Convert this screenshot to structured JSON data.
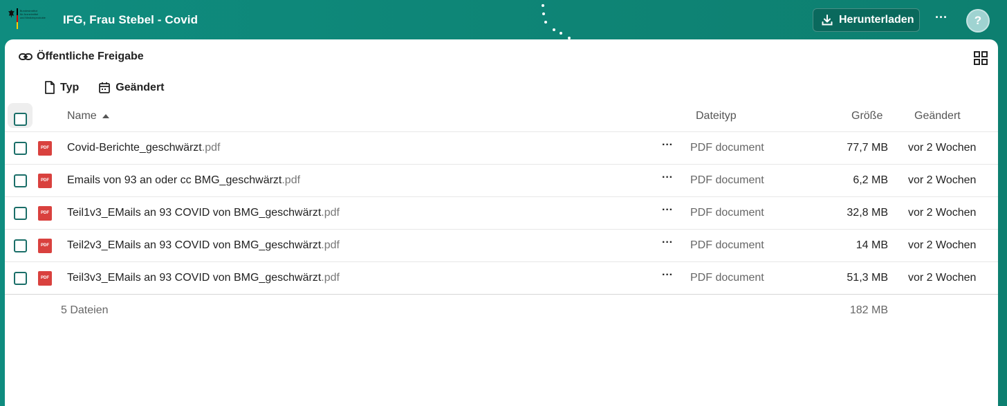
{
  "header": {
    "logo_text": [
      "Bundesinstitut",
      "für Arzneimittel",
      "und Medizinprodukte"
    ],
    "title": "IFG, Frau Stebel - Covid",
    "download_label": "Herunterladen",
    "more_label": "···",
    "help_label": "?"
  },
  "share": {
    "title": "Öffentliche Freigabe"
  },
  "sort": {
    "type_label": "Typ",
    "modified_label": "Geändert"
  },
  "columns": {
    "name": "Name",
    "type": "Dateityp",
    "size": "Größe",
    "modified": "Geändert"
  },
  "files": [
    {
      "name": "Covid-Berichte_geschwärzt",
      "ext": ".pdf",
      "type": "PDF document",
      "size": "77,7 MB",
      "modified": "vor 2 Wochen",
      "icon_label": "PDF"
    },
    {
      "name": "Emails von 93 an oder cc BMG_geschwärzt",
      "ext": ".pdf",
      "type": "PDF document",
      "size": "6,2 MB",
      "modified": "vor 2 Wochen",
      "icon_label": "PDF"
    },
    {
      "name": "Teil1v3_EMails an 93 COVID von BMG_geschwärzt",
      "ext": ".pdf",
      "type": "PDF document",
      "size": "32,8 MB",
      "modified": "vor 2 Wochen",
      "icon_label": "PDF"
    },
    {
      "name": "Teil2v3_EMails an 93 COVID von BMG_geschwärzt",
      "ext": ".pdf",
      "type": "PDF document",
      "size": "14 MB",
      "modified": "vor 2 Wochen",
      "icon_label": "PDF"
    },
    {
      "name": "Teil3v3_EMails an 93 COVID von BMG_geschwärzt",
      "ext": ".pdf",
      "type": "PDF document",
      "size": "51,3 MB",
      "modified": "vor 2 Wochen",
      "icon_label": "PDF"
    }
  ],
  "row_more_label": "···",
  "summary": {
    "count": "5 Dateien",
    "total_size": "182 MB"
  },
  "colors": {
    "accent": "#0e8576",
    "checkbox": "#1a6e68",
    "pdf": "#d9413e"
  }
}
